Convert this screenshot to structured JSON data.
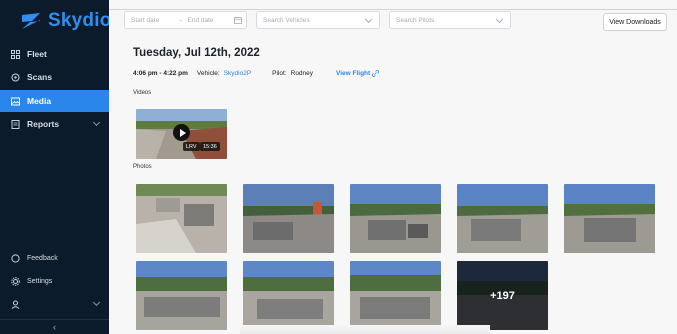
{
  "app": {
    "brand": "Skydio",
    "brand_color": "#2a86ea",
    "sidebar_bg": "#0b1b2b"
  },
  "sidebar": {
    "items": [
      {
        "label": "Fleet",
        "icon": "grid-icon",
        "active": false
      },
      {
        "label": "Scans",
        "icon": "scan-icon",
        "active": false
      },
      {
        "label": "Media",
        "icon": "image-icon",
        "active": true
      },
      {
        "label": "Reports",
        "icon": "report-icon",
        "active": false,
        "expandable": true
      }
    ],
    "bottom_items": [
      {
        "label": "Feedback",
        "icon": "feedback-icon"
      },
      {
        "label": "Settings",
        "icon": "gear-icon"
      }
    ],
    "user_icon": "user-icon",
    "collapse_label": "‹"
  },
  "filters": {
    "start_date_placeholder": "Start date",
    "end_date_placeholder": "End date",
    "separator": "→",
    "vehicles_placeholder": "Search Vehicles",
    "pilots_placeholder": "Search Pilots"
  },
  "toolbar": {
    "downloads_label": "View Downloads"
  },
  "flight": {
    "date_title": "Tuesday, Jul 12th, 2022",
    "time_range": "4:06 pm - 4:22 pm",
    "vehicle_label": "Vehicle:",
    "vehicle_name": "Skydio2P",
    "pilot_label": "Pilot:",
    "pilot_name": "Rodney",
    "view_flight_label": "View Flight",
    "link_icon": "link-icon"
  },
  "videos": {
    "section_label": "Videos",
    "items": [
      {
        "quality": "LRV",
        "duration": "15:36"
      }
    ]
  },
  "photos": {
    "section_label": "Photos",
    "visible_count": 9,
    "more_label": "+197"
  }
}
